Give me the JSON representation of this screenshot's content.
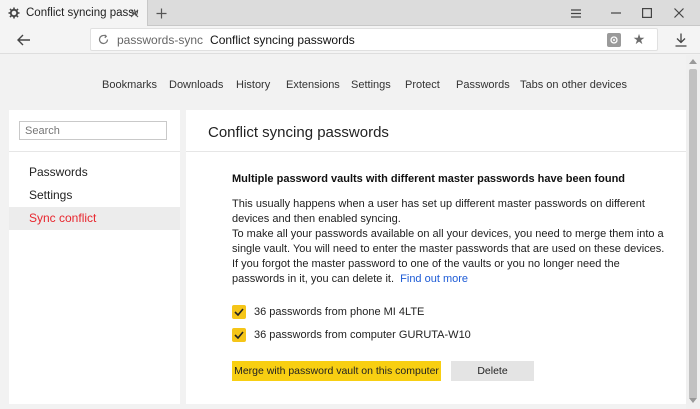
{
  "window": {
    "tab_title": "Conflict syncing passwords",
    "new_tab_icon": "plus-icon",
    "controls": [
      "menu-icon",
      "minimize-icon",
      "maximize-icon",
      "close-icon"
    ]
  },
  "address": {
    "host": "passwords-sync",
    "page_title": "Conflict syncing passwords"
  },
  "nav": {
    "items": [
      "Bookmarks",
      "Downloads",
      "History",
      "Extensions",
      "Settings",
      "Protect",
      "Passwords",
      "Tabs on other devices"
    ]
  },
  "sidebar": {
    "search_placeholder": "Search",
    "items": [
      {
        "label": "Passwords",
        "active": false
      },
      {
        "label": "Settings",
        "active": false
      },
      {
        "label": "Sync conflict",
        "active": true
      }
    ]
  },
  "main": {
    "title": "Conflict syncing passwords",
    "headline": "Multiple password vaults with different master passwords have been found",
    "para1": "This usually happens when a user has set up different master passwords on different devices and then enabled syncing.",
    "para2": "To make all your passwords available on all your devices, you need to merge them into a single vault. You will need to enter the master passwords that are used on these devices.",
    "para3": "If you forgot the master password to one of the vaults or you no longer need the passwords in it, you can delete it.",
    "find_out_more": "Find out more",
    "checkboxes": [
      {
        "label": "36 passwords from phone MI 4LTE",
        "checked": true
      },
      {
        "label": "36 passwords from computer GURUTA-W10",
        "checked": true
      }
    ],
    "merge_button": "Merge with password vault on this computer",
    "delete_button": "Delete"
  },
  "colors": {
    "accent_yellow": "#f8cf12",
    "active_red": "#e8262e",
    "link_blue": "#1d5bd6"
  }
}
